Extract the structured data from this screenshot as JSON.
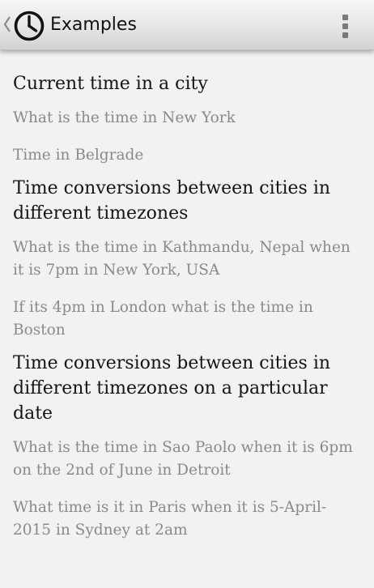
{
  "action_bar": {
    "title": "Examples",
    "back_icon": "chevron-left-icon",
    "app_icon": "clock-icon",
    "menu_icon": "overflow-menu-icon"
  },
  "sections": [
    {
      "heading": "Current time in a city",
      "examples": [
        "What is the time in New York",
        "Time in Belgrade"
      ]
    },
    {
      "heading": "Time conversions between cities in different timezones",
      "examples": [
        "What is the time in Kathmandu, Nepal when it is 7pm in New York, USA",
        "If its 4pm in London what is the time in Boston"
      ]
    },
    {
      "heading": "Time conversions between cities in different timezones on a particular date",
      "examples": [
        "What is the time in Sao Paolo when it is 6pm on the 2nd of June in Detroit",
        "What time is it in Paris when it is 5-April-2015 in Sydney at 2am"
      ]
    }
  ],
  "colors": {
    "background": "#f2f2f2",
    "heading_text": "#141414",
    "example_text": "#8a8a8a"
  }
}
